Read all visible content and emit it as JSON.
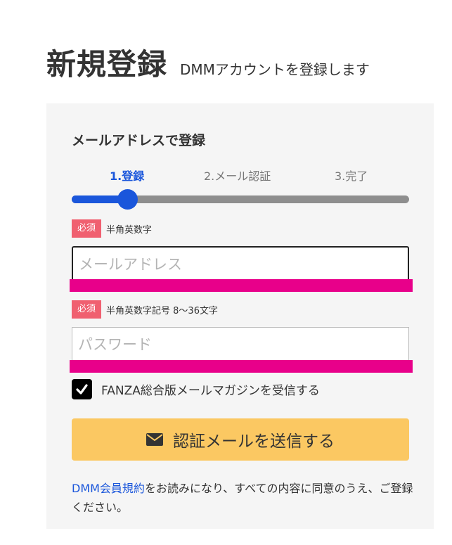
{
  "header": {
    "title": "新規登録",
    "subtitle": "DMMアカウントを登録します"
  },
  "form": {
    "heading": "メールアドレスで登録",
    "steps": [
      {
        "label": "1.登録",
        "active": true
      },
      {
        "label": "2.メール認証",
        "active": false
      },
      {
        "label": "3.完了",
        "active": false
      }
    ],
    "progress_fraction": 0.165,
    "colors": {
      "accent": "#1a56db",
      "required_badge": "#f06070",
      "error_bar": "#e8008a",
      "submit_button": "#fbc862"
    },
    "email": {
      "required_label": "必須",
      "hint": "半角英数字",
      "placeholder": "メールアドレス",
      "value": ""
    },
    "password": {
      "required_label": "必須",
      "hint": "半角英数字記号 8～36文字",
      "placeholder": "パスワード",
      "value": ""
    },
    "newsletter": {
      "label": "FANZA総合版メールマガジンを受信する",
      "checked": true,
      "icon": "checkmark-icon"
    },
    "submit": {
      "label": "認証メールを送信する",
      "icon": "envelope-icon"
    },
    "agreement": {
      "link_text": "DMM会員規約",
      "text": "をお読みになり、すべての内容に同意のうえ、ご登録ください。"
    }
  }
}
